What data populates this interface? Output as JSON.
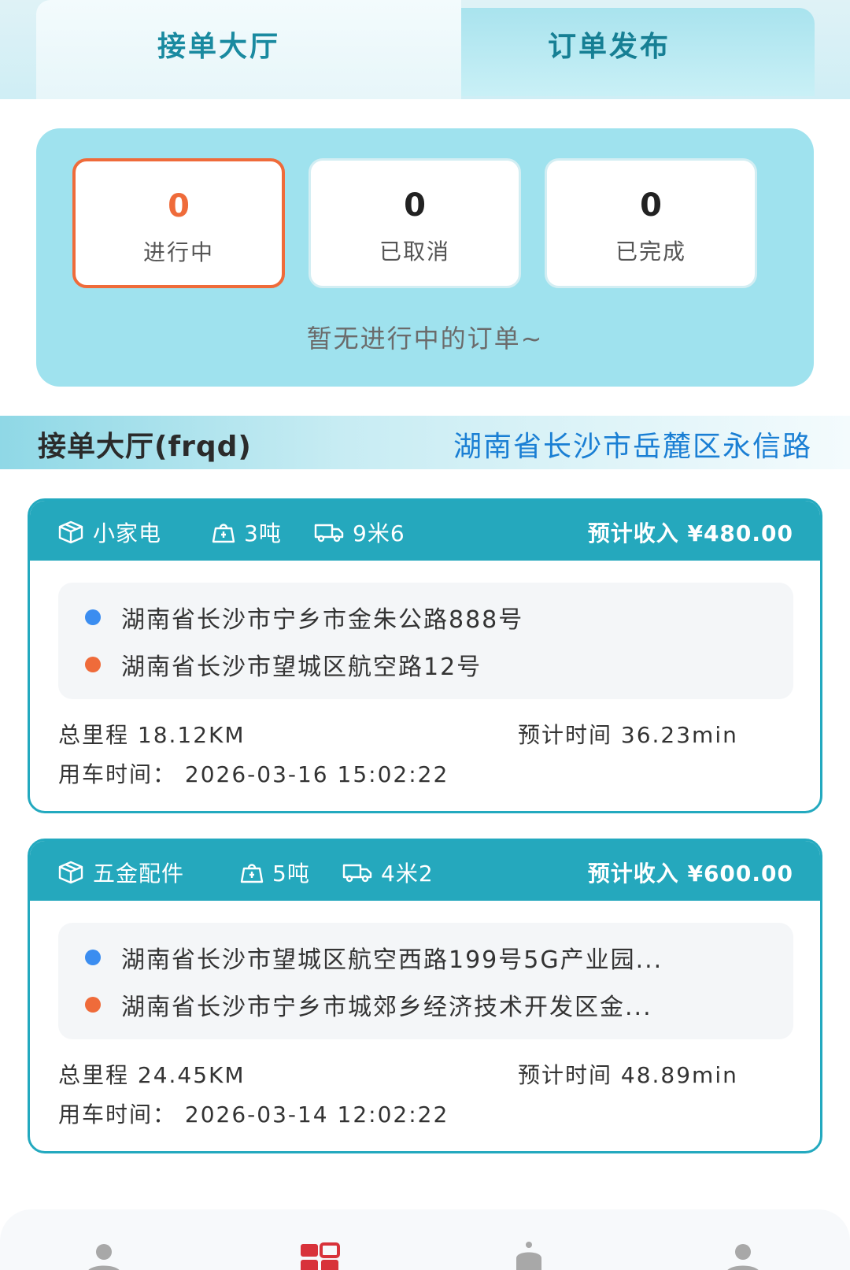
{
  "tabs": [
    {
      "label": "接单大厅",
      "active": true
    },
    {
      "label": "订单发布",
      "active": false
    }
  ],
  "stats": [
    {
      "value": "0",
      "label": "进行中",
      "active": true
    },
    {
      "value": "0",
      "label": "已取消",
      "active": false
    },
    {
      "value": "0",
      "label": "已完成",
      "active": false
    }
  ],
  "empty_message": "暂无进行中的订单~",
  "section": {
    "title": "接单大厅(frqd)",
    "location": "湖南省长沙市岳麓区永信路"
  },
  "orders": [
    {
      "cargo": "小家电",
      "weight": "3吨",
      "vehicle": "9米6",
      "income": "预计收入 ¥480.00",
      "from": "湖南省长沙市宁乡市金朱公路888号",
      "to": "湖南省长沙市望城区航空路12号",
      "distance": "总里程  18.12KM",
      "eta": "预计时间 36.23min",
      "use_time": "用车时间：  2026-03-16 15:02:22"
    },
    {
      "cargo": "五金配件",
      "weight": "5吨",
      "vehicle": "4米2",
      "income": "预计收入 ¥600.00",
      "from": "湖南省长沙市望城区航空西路199号5G产业园...",
      "to": "湖南省长沙市宁乡市城郊乡经济技术开发区金...",
      "distance": "总里程  24.45KM",
      "eta": "预计时间 48.89min",
      "use_time": "用车时间：  2026-03-14 12:02:22"
    }
  ],
  "colors": {
    "accent": "#25a8bd",
    "active_orange": "#ef6b3a",
    "location_blue": "#1a7fd4",
    "stats_bg": "#9fe2ee"
  },
  "icons": {
    "cargo": "box-icon",
    "weight": "weight-icon",
    "vehicle": "truck-icon",
    "nav": [
      "person-icon",
      "grid-icon",
      "bell-icon",
      "profile-icon"
    ]
  }
}
